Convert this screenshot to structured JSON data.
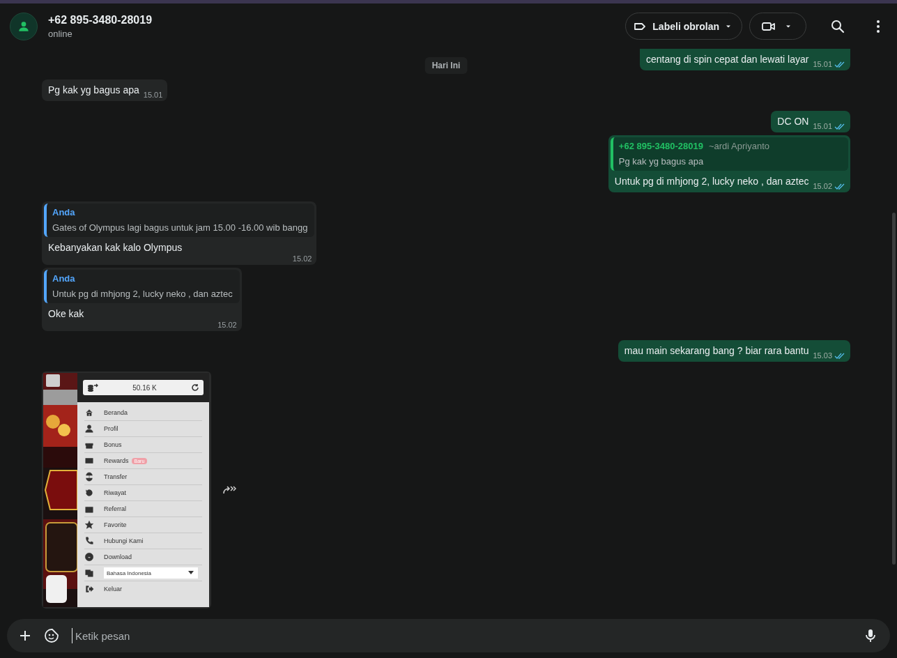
{
  "header": {
    "name": "+62 895-3480-28019",
    "status": "online",
    "label_button": "Labeli obrolan"
  },
  "date_chip": "Hari Ini",
  "messages": [
    {
      "kind": "text",
      "outgoing": true,
      "text": "centang di spin cepat dan lewati layar",
      "time": "15.01",
      "read": true
    },
    {
      "kind": "text",
      "outgoing": false,
      "text": "Pg kak yg bagus apa",
      "time": "15.01"
    },
    {
      "kind": "text",
      "outgoing": true,
      "text": "DC ON",
      "time": "15.01",
      "read": true
    },
    {
      "kind": "text",
      "outgoing": true,
      "quote": {
        "author": "+62 895-3480-28019",
        "note": "~ardi Apriyanto",
        "text": "Pg kak yg bagus apa"
      },
      "text": "Untuk pg di mhjong 2, lucky neko , dan aztec",
      "time": "15.02",
      "read": true
    },
    {
      "kind": "text",
      "outgoing": false,
      "quote": {
        "author": "Anda",
        "text": "Gates of Olympus lagi bagus untuk jam 15.00 -16.00 wib bangg"
      },
      "text": "Kebanyakan kak kalo Olympus",
      "time": "15.02"
    },
    {
      "kind": "text",
      "outgoing": false,
      "quote": {
        "author": "Anda",
        "text": "Untuk pg di mhjong 2, lucky neko , dan aztec"
      },
      "text": "Oke kak",
      "time": "15.02"
    },
    {
      "kind": "text",
      "outgoing": true,
      "text": "mau main sekarang bang ? biar rara bantu",
      "time": "15.03",
      "read": true
    },
    {
      "outgoing": false,
      "screenshot": {
        "balance": "50.16 K",
        "menu": [
          {
            "kind": "link",
            "label": "Beranda"
          },
          {
            "kind": "link",
            "label": "Profil"
          },
          {
            "kind": "link",
            "label": "Bonus"
          },
          {
            "kind": "link",
            "label": "Rewards",
            "badge": "Baru"
          },
          {
            "kind": "link",
            "label": "Transfer"
          },
          {
            "kind": "link",
            "label": "Riwayat"
          },
          {
            "kind": "link",
            "label": "Referral"
          },
          {
            "kind": "link",
            "label": "Favorite"
          },
          {
            "kind": "link",
            "label": "Hubungi Kami"
          },
          {
            "kind": "link",
            "label": "Download"
          },
          {
            "kind": "select",
            "label": "Bahasa Indonesia"
          },
          {
            "kind": "link",
            "label": "Keluar"
          }
        ]
      }
    }
  ],
  "composer": {
    "placeholder": "Ketik pesan"
  }
}
